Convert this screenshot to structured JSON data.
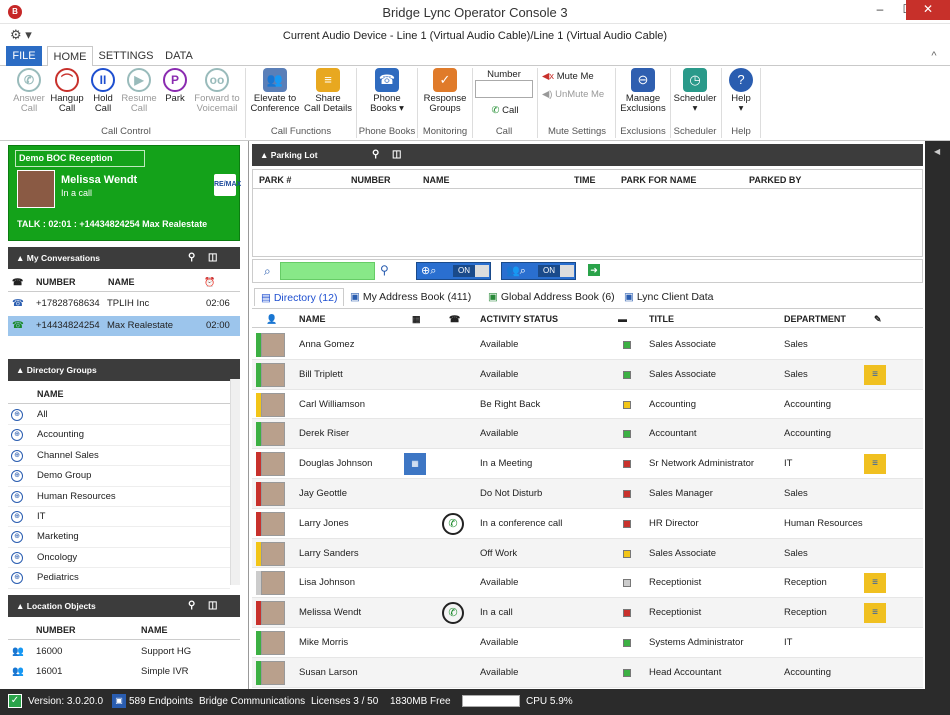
{
  "window": {
    "title": "Bridge Lync Operator Console 3",
    "app_icon": "B",
    "min": "–",
    "max": "☐",
    "close": "✕"
  },
  "qat": {
    "gear": "⚙ ▾",
    "device": "Current Audio Device - Line 1 (Virtual Audio Cable)/Line 1 (Virtual Audio Cable)"
  },
  "tabs": {
    "file": "FILE",
    "home": "HOME",
    "settings": "SETTINGS",
    "data": "DATA",
    "collapse": "^"
  },
  "ribbon": {
    "answer": {
      "l1": "Answer",
      "l2": "Call"
    },
    "hangup": {
      "l1": "Hangup",
      "l2": "Call"
    },
    "hold": {
      "l1": "Hold",
      "l2": "Call"
    },
    "resume": {
      "l1": "Resume",
      "l2": "Call"
    },
    "park": {
      "l1": "Park",
      "l2": ""
    },
    "forward": {
      "l1": "Forward to",
      "l2": "Voicemail"
    },
    "call_control": "Call Control",
    "elevate": {
      "l1": "Elevate to",
      "l2": "Conference"
    },
    "share": {
      "l1": "Share",
      "l2": "Call Details"
    },
    "call_functions": "Call Functions",
    "phonebooks": {
      "l1": "Phone",
      "l2": "Books ▾"
    },
    "phonebooks_group": "Phone Books",
    "response": {
      "l1": "Response",
      "l2": "Groups"
    },
    "monitoring": "Monitoring",
    "number_label": "Number",
    "call_btn": "Call",
    "call_group": "Call",
    "mute": "Mute Me",
    "unmute": "UnMute Me",
    "mute_group": "Mute Settings",
    "manage": {
      "l1": "Manage",
      "l2": "Exclusions"
    },
    "exclusions": "Exclusions",
    "scheduler": {
      "l1": "Scheduler",
      "l2": "▾"
    },
    "scheduler_group": "Scheduler",
    "help": {
      "l1": "Help",
      "l2": "▾"
    },
    "help_group": "Help"
  },
  "status_card": {
    "title": "Demo BOC Reception",
    "name": "Melissa Wendt",
    "state": "In a call",
    "talk": "TALK : 02:01 : +14434824254 Max Realestate",
    "logo": "RE/MAX"
  },
  "conversations": {
    "header": "My Conversations",
    "cols": {
      "number": "NUMBER",
      "name": "NAME"
    },
    "rows": [
      {
        "number": "+17828768634",
        "name": "TPLIH Inc",
        "time": "02:06"
      },
      {
        "number": "+14434824254",
        "name": "Max Realestate",
        "time": "02:00"
      }
    ]
  },
  "dir_groups": {
    "header": "Directory Groups",
    "col": "NAME",
    "items": [
      "All",
      "Accounting",
      "Channel Sales",
      "Demo Group",
      "Human Resources",
      "IT",
      "Marketing",
      "Oncology",
      "Pediatrics"
    ]
  },
  "location": {
    "header": "Location Objects",
    "cols": {
      "number": "NUMBER",
      "name": "NAME"
    },
    "rows": [
      {
        "number": "16000",
        "name": "Support HG"
      },
      {
        "number": "16001",
        "name": "Simple IVR"
      }
    ]
  },
  "parking": {
    "header": "Parking Lot",
    "cols": {
      "park": "PARK #",
      "number": "NUMBER",
      "name": "NAME",
      "time": "TIME",
      "parkfor": "PARK FOR NAME",
      "parkedby": "PARKED BY"
    }
  },
  "search": {
    "on1": "ON",
    "on2": "ON"
  },
  "dir_tabs": {
    "directory": "Directory (12)",
    "address": "My Address Book (411)",
    "global": "Global Address Book (6)",
    "lync": "Lync Client Data"
  },
  "dir_cols": {
    "name": "NAME",
    "activity": "ACTIVITY STATUS",
    "title": "TITLE",
    "dept": "DEPARTMENT"
  },
  "directory": [
    {
      "name": "Anna Gomez",
      "activity": "Available",
      "title": "Sales Associate",
      "dept": "Sales",
      "status": "#3cb043",
      "note": false,
      "cal": false,
      "call": false
    },
    {
      "name": "Bill Triplett",
      "activity": "Available",
      "title": "Sales Associate",
      "dept": "Sales",
      "status": "#3cb043",
      "note": true,
      "cal": false,
      "call": false
    },
    {
      "name": "Carl Williamson",
      "activity": "Be Right Back",
      "title": "Accounting",
      "dept": "Accounting",
      "status": "#f2c518",
      "note": false,
      "cal": false,
      "call": false
    },
    {
      "name": "Derek Riser",
      "activity": "Available",
      "title": "Accountant",
      "dept": "Accounting",
      "status": "#3cb043",
      "note": false,
      "cal": false,
      "call": false
    },
    {
      "name": "Douglas Johnson",
      "activity": "In a Meeting",
      "title": "Sr Network Administrator",
      "dept": "IT",
      "status": "#c8312c",
      "note": true,
      "cal": true,
      "call": false
    },
    {
      "name": "Jay Geottle",
      "activity": "Do Not Disturb",
      "title": "Sales Manager",
      "dept": "Sales",
      "status": "#c8312c",
      "note": false,
      "cal": false,
      "call": false
    },
    {
      "name": "Larry Jones",
      "activity": "In a conference call",
      "title": "HR Director",
      "dept": "Human Resources",
      "status": "#c8312c",
      "note": false,
      "cal": false,
      "call": true
    },
    {
      "name": "Larry Sanders",
      "activity": "Off Work",
      "title": "Sales Associate",
      "dept": "Sales",
      "status": "#f2c518",
      "note": false,
      "cal": false,
      "call": false
    },
    {
      "name": "Lisa Johnson",
      "activity": "Available",
      "title": "Receptionist",
      "dept": "Reception",
      "status": "#cccccc",
      "note": true,
      "cal": false,
      "call": false
    },
    {
      "name": "Melissa Wendt",
      "activity": "In a call",
      "title": "Receptionist",
      "dept": "Reception",
      "status": "#c8312c",
      "note": true,
      "cal": false,
      "call": true
    },
    {
      "name": "Mike Morris",
      "activity": "Available",
      "title": "Systems Administrator",
      "dept": "IT",
      "status": "#3cb043",
      "note": false,
      "cal": false,
      "call": false
    },
    {
      "name": "Susan Larson",
      "activity": "Available",
      "title": "Head Accountant",
      "dept": "Accounting",
      "status": "#3cb043",
      "note": false,
      "cal": false,
      "call": false
    }
  ],
  "statusbar": {
    "version": "Version: 3.0.20.0",
    "endpoints": "589 Endpoints",
    "company": "Bridge Communications",
    "licenses": "Licenses  3  /  50",
    "memory": "1830MB Free",
    "cpu": "CPU 5.9%"
  }
}
